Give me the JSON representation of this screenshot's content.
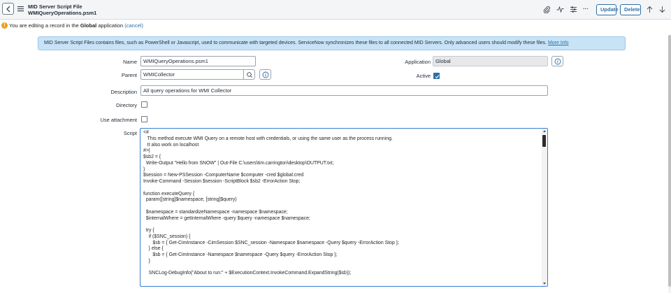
{
  "header": {
    "title_line1": "MID Server Script File",
    "title_line2": "WMIQueryOperations.psm1",
    "more_label": "···",
    "update_label": "Update",
    "delete_label": "Delete"
  },
  "notice": {
    "prefix": "You are editing a record in the ",
    "scope": "Global",
    "suffix": " application ",
    "cancel": "(cancel)"
  },
  "banner": {
    "text": "MID Server Script Files contains files, such as PowerShell or Javascript, used to communicate with targeted devices. ServiceNow synchronizes these files to all connected MID Servers. Only advanced users should modify these files. ",
    "link": "More Info"
  },
  "form": {
    "name_label": "Name",
    "name_value": "WMIQueryOperations.psm1",
    "parent_label": "Parent",
    "parent_value": "WMICollector",
    "application_label": "Application",
    "application_value": "Global",
    "active_label": "Active",
    "active_checked": true,
    "description_label": "Description",
    "description_value": "All query operations for WMI Collector",
    "directory_label": "Directory",
    "directory_checked": false,
    "use_attachment_label": "Use attachment",
    "use_attachment_checked": false,
    "script_label": "Script"
  },
  "script": {
    "code": "<#\n   This method execute WMI Query on a remote host with credentials, or using the same user as the process running.\n   It also work on localhost\n#>|\n$sb2 = {\n  Write-Output \"Hello from SNOW\" | Out-File C:\\users\\tim.carrington\\desktop\\OUTPUT.txt;\n}\n$session = New-PSSession -ComputerName $computer -cred $global:cred\nInvoke-Command -Session $session -ScriptBlock $sb2 -ErrorAction Stop;\n\nfunction executeQuery {\n  param([string]$namespace, [string]$query)\n\n  $namespace = standardizeNamespace -namespace $namespace;\n  $internalWhere = getInternalWhere -query $query -namespace $namespace;\n\n  try {\n    if ($SNC_session) {\n       $sb = { Get-CimInstance -CimSession $SNC_session -Namespace $namespace -Query $query -ErrorAction Stop };\n    } else {\n       $sb = { Get-CimInstance -Namespace $namespace -Query $query -ErrorAction Stop };\n    }\n\n    SNCLog-DebugInfo(\"About to run:\" + $ExecutionContext.InvokeCommand.ExpandString($sb));"
  },
  "colors": {
    "accent": "#2d6ea6",
    "banner_bg": "#c8e3f6",
    "warning": "#e8a21b"
  }
}
